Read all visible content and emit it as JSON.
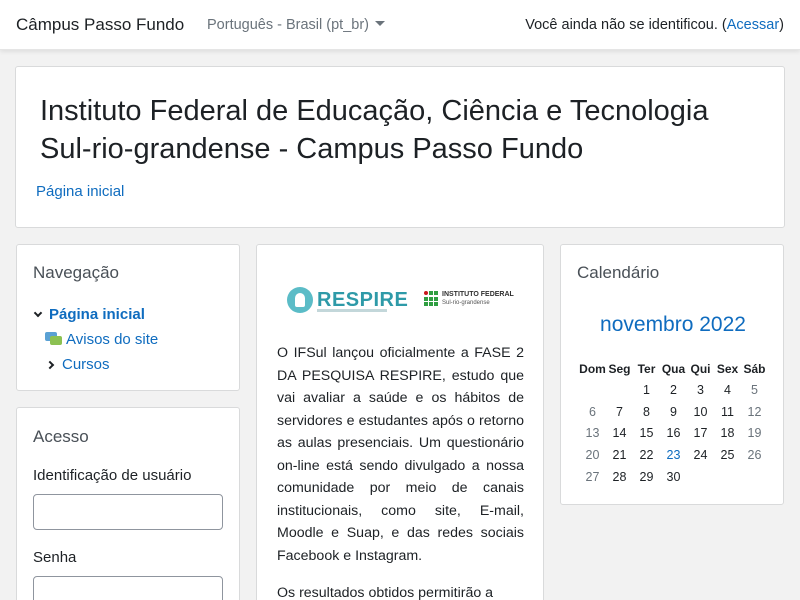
{
  "navbar": {
    "brand": "Câmpus Passo Fundo",
    "language": "Português - Brasil (pt_br)",
    "login_prefix": "Você ainda não se identificou. (",
    "login_link": "Acessar",
    "login_suffix": ")"
  },
  "header": {
    "title": "Instituto Federal de Educação, Ciência e Tecnologia Sul-rio-grandense - Campus Passo Fundo",
    "breadcrumb": "Página inicial"
  },
  "navigation": {
    "title": "Navegação",
    "items": [
      {
        "label": "Página inicial"
      },
      {
        "label": "Avisos do site"
      },
      {
        "label": "Cursos"
      }
    ]
  },
  "login": {
    "title": "Acesso",
    "username_label": "Identificação de usuário",
    "username_value": "",
    "password_label": "Senha",
    "password_value": ""
  },
  "news": {
    "logo_left": "RESPIRE",
    "logo_right_line1": "INSTITUTO FEDERAL",
    "logo_right_line2": "Sul-rio-grandense",
    "paragraph1": "O IFSul lançou oficialmente a FASE 2 DA PESQUISA RESPIRE, estudo que vai avaliar a saúde e os hábitos de servidores e estudantes após o retorno as aulas presenciais. Um questionário on-line está sendo divulgado a nossa comunidade por meio de canais institucionais, como site, E-mail, Moodle e Suap, e das redes sociais Facebook e Instagram.",
    "paragraph2": "Os resultados obtidos permitirão a"
  },
  "calendar": {
    "title": "Calendário",
    "month": "novembro 2022",
    "weekdays": [
      "Dom",
      "Seg",
      "Ter",
      "Qua",
      "Qui",
      "Sex",
      "Sáb"
    ],
    "weeks": [
      [
        "",
        "",
        "1",
        "2",
        "3",
        "4",
        "5"
      ],
      [
        "6",
        "7",
        "8",
        "9",
        "10",
        "11",
        "12"
      ],
      [
        "13",
        "14",
        "15",
        "16",
        "17",
        "18",
        "19"
      ],
      [
        "20",
        "21",
        "22",
        "23",
        "24",
        "25",
        "26"
      ],
      [
        "27",
        "28",
        "29",
        "30",
        "",
        "",
        ""
      ]
    ],
    "today": "23",
    "colors": {
      "link": "#0f6cbf",
      "weekend": "#6a737b"
    }
  }
}
